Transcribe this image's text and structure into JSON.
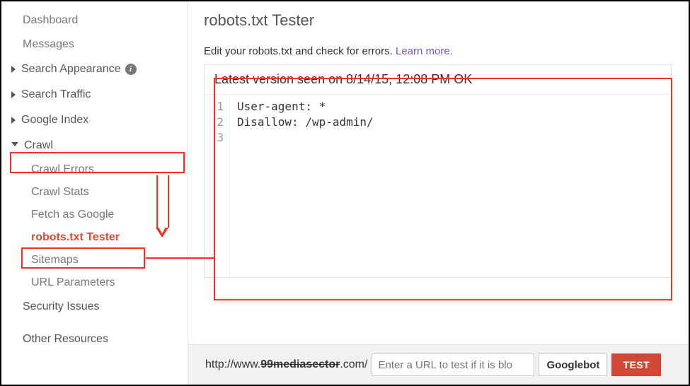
{
  "sidebar": {
    "top": {
      "dashboard": "Dashboard",
      "messages": "Messages"
    },
    "cats": {
      "search_appearance": "Search Appearance",
      "search_traffic": "Search Traffic",
      "google_index": "Google Index",
      "crawl": "Crawl"
    },
    "crawl_sub": {
      "errors": "Crawl Errors",
      "stats": "Crawl Stats",
      "fetch": "Fetch as Google",
      "robots": "robots.txt Tester",
      "sitemaps": "Sitemaps",
      "urlparams": "URL Parameters"
    },
    "bottom": {
      "security": "Security Issues",
      "other": "Other Resources"
    }
  },
  "main": {
    "title": "robots.txt Tester",
    "desc_prefix": "Edit your robots.txt and check for errors. ",
    "learn_more": "Learn more.",
    "editor": {
      "status_prefix": "Latest version seen on ",
      "status_date": "8/14/15, 12:08 PM",
      "status_ok": " OK",
      "line1": "User-agent: *",
      "line2": "Disallow: /wp-admin/",
      "g1": "1",
      "g2": "2",
      "g3": "3"
    },
    "bottom": {
      "url_prefix": "http://www.",
      "url_redacted": "99mediasector",
      "url_suffix": ".com/",
      "placeholder": "Enter a URL to test if it is blo",
      "bot": "Googlebot",
      "test": "TEST"
    }
  }
}
